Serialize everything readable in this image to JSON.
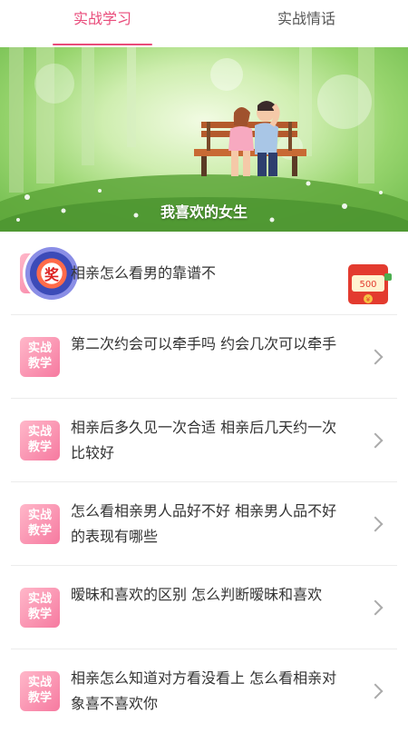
{
  "tabs": [
    {
      "label": "实战学习",
      "active": true
    },
    {
      "label": "实战情话",
      "active": false
    }
  ],
  "banner": {
    "title": "我喜欢的女生"
  },
  "prize_badge": {
    "text": "奖"
  },
  "red_packet": {
    "amount": "500",
    "currency": "¥"
  },
  "thumb_label": {
    "line1": "实战",
    "line2": "教学"
  },
  "articles": [
    {
      "title": "相亲怎么看男的靠谱不"
    },
    {
      "title": "第二次约会可以牵手吗 约会几次可以牵手"
    },
    {
      "title": "相亲后多久见一次合适 相亲后几天约一次比较好"
    },
    {
      "title": "怎么看相亲男人品好不好 相亲男人品不好的表现有哪些"
    },
    {
      "title": "暧昧和喜欢的区别 怎么判断暧昧和喜欢"
    },
    {
      "title": "相亲怎么知道对方看没看上 怎么看相亲对象喜不喜欢你"
    }
  ],
  "colors": {
    "accent": "#e94b7a",
    "thumb_start": "#ffb7c9",
    "thumb_end": "#f67aa0"
  }
}
